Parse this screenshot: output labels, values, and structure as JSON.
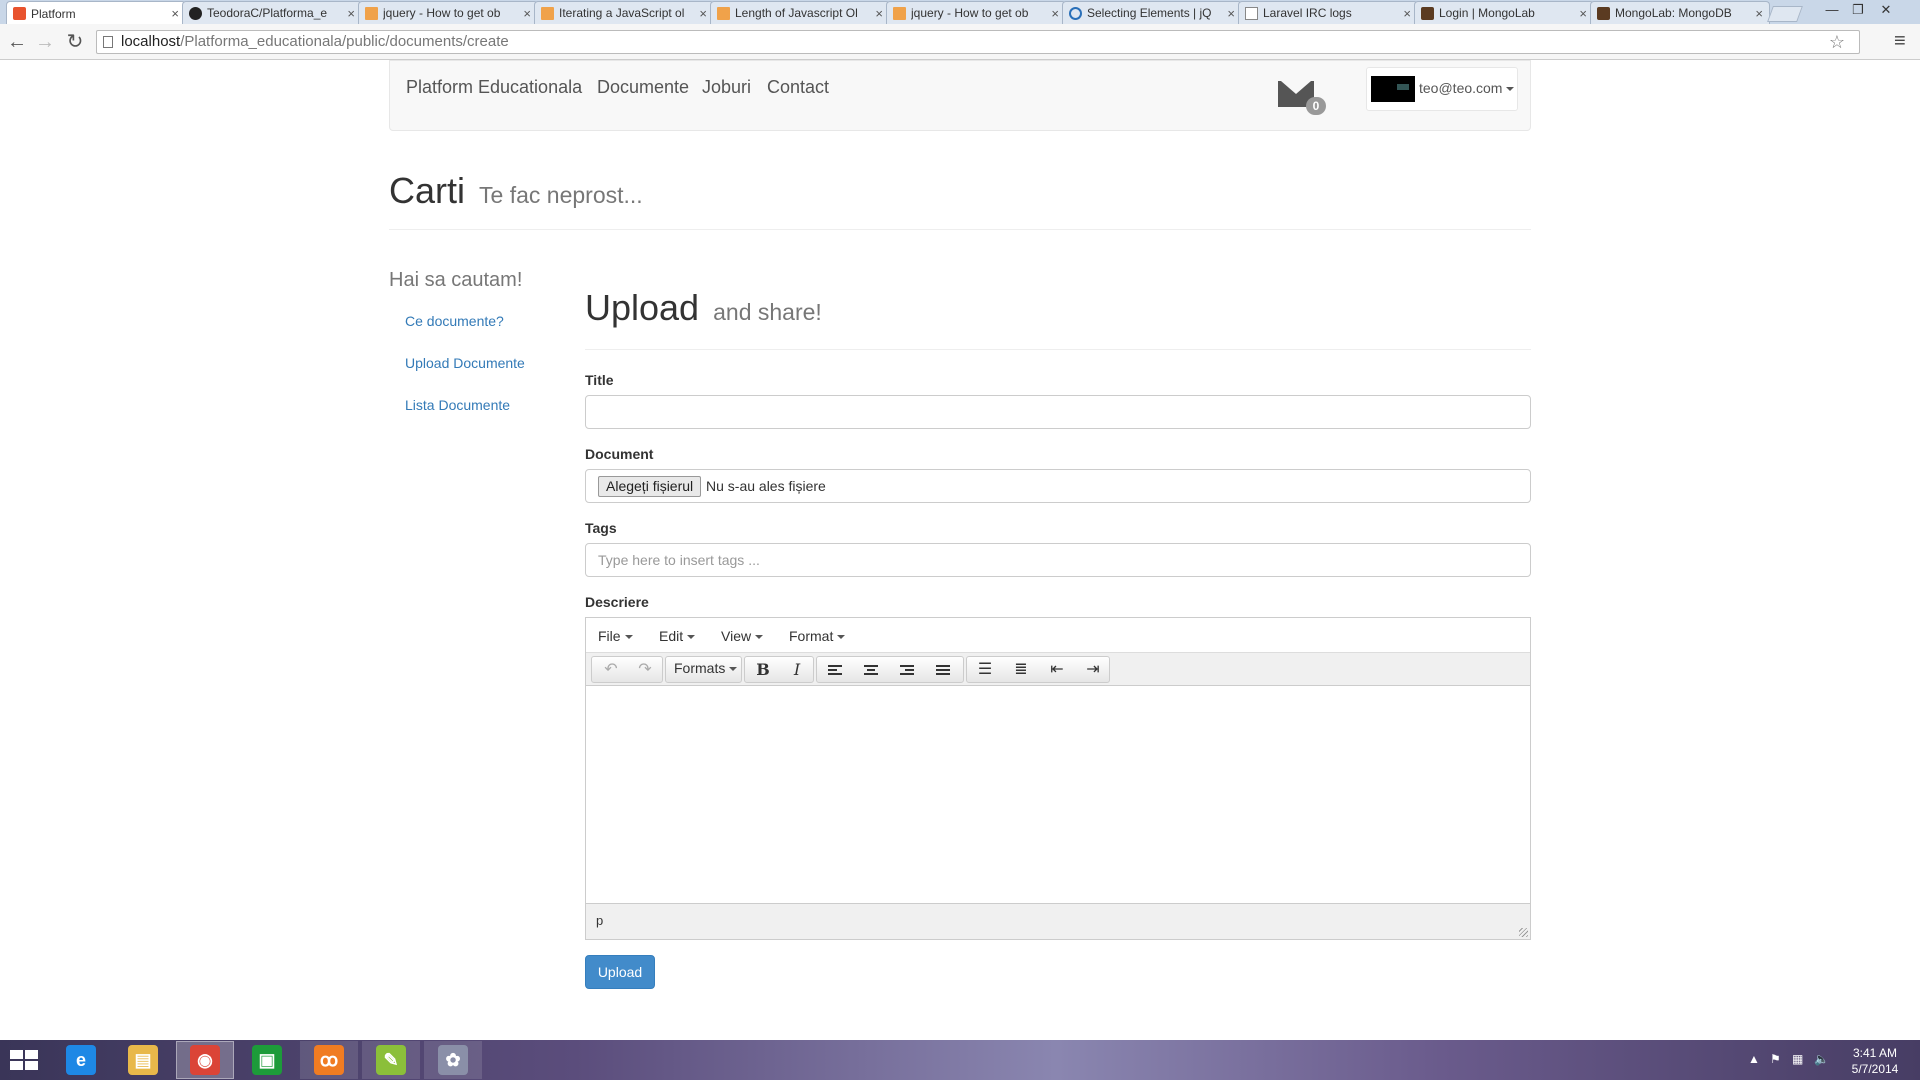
{
  "browser": {
    "tabs": [
      {
        "label": "Platform",
        "icon": "laravel-favicon",
        "active": true
      },
      {
        "label": "TeodoraC/Platforma_e",
        "icon": "github-favicon"
      },
      {
        "label": "jquery - How to get ob",
        "icon": "stackoverflow-favicon"
      },
      {
        "label": "Iterating a JavaScript ol",
        "icon": "stackoverflow-favicon"
      },
      {
        "label": "Length of Javascript Ol",
        "icon": "stackoverflow-favicon"
      },
      {
        "label": "jquery - How to get ob",
        "icon": "stackoverflow-favicon"
      },
      {
        "label": "Selecting Elements | jQ",
        "icon": "jquery-favicon"
      },
      {
        "label": "Laravel IRC logs",
        "icon": "document-favicon"
      },
      {
        "label": "Login | MongoLab",
        "icon": "mongolab-favicon"
      },
      {
        "label": "MongoLab: MongoDB",
        "icon": "mongolab-favicon"
      }
    ],
    "tab_close_glyph": "×",
    "url_host": "localhost",
    "url_path": "/Platforma_educationala/public/documents/create"
  },
  "navbar": {
    "brand": "Platform Educationala",
    "links": [
      "Documente",
      "Joburi",
      "Contact"
    ],
    "mail_count": "0",
    "user_email": "teo@teo.com"
  },
  "header": {
    "title": "Carti",
    "subtitle": "Te fac neprost..."
  },
  "sidebar": {
    "title": "Hai sa cautam!",
    "links": [
      "Ce documente?",
      "Upload Documente",
      "Lista Documente"
    ]
  },
  "form": {
    "title": "Upload",
    "subtitle": "and share!",
    "title_label": "Title",
    "title_value": "",
    "document_label": "Document",
    "file_button": "Alegeți fișierul",
    "file_status": "Nu s-au ales fișiere",
    "tags_label": "Tags",
    "tags_placeholder": "Type here to insert tags ...",
    "description_label": "Descriere",
    "submit": "Upload"
  },
  "editor": {
    "menus": [
      "File",
      "Edit",
      "View",
      "Format"
    ],
    "formats_label": "Formats",
    "status_path": "p"
  },
  "taskbar": {
    "apps": [
      {
        "name": "internet-explorer",
        "glyph": "e",
        "color": "#1e88e5"
      },
      {
        "name": "file-explorer",
        "glyph": "▤",
        "color": "#e8b84a"
      },
      {
        "name": "chrome",
        "glyph": "◉",
        "color": "#db4437"
      },
      {
        "name": "store",
        "glyph": "▣",
        "color": "#1d9b3a"
      },
      {
        "name": "xampp",
        "glyph": "ꝏ",
        "color": "#f07c22"
      },
      {
        "name": "notepad-plus",
        "glyph": "✎",
        "color": "#8bbf3a"
      },
      {
        "name": "paint",
        "glyph": "✿",
        "color": "#8a8fa8"
      }
    ],
    "time": "3:41 AM",
    "date": "5/7/2014"
  }
}
